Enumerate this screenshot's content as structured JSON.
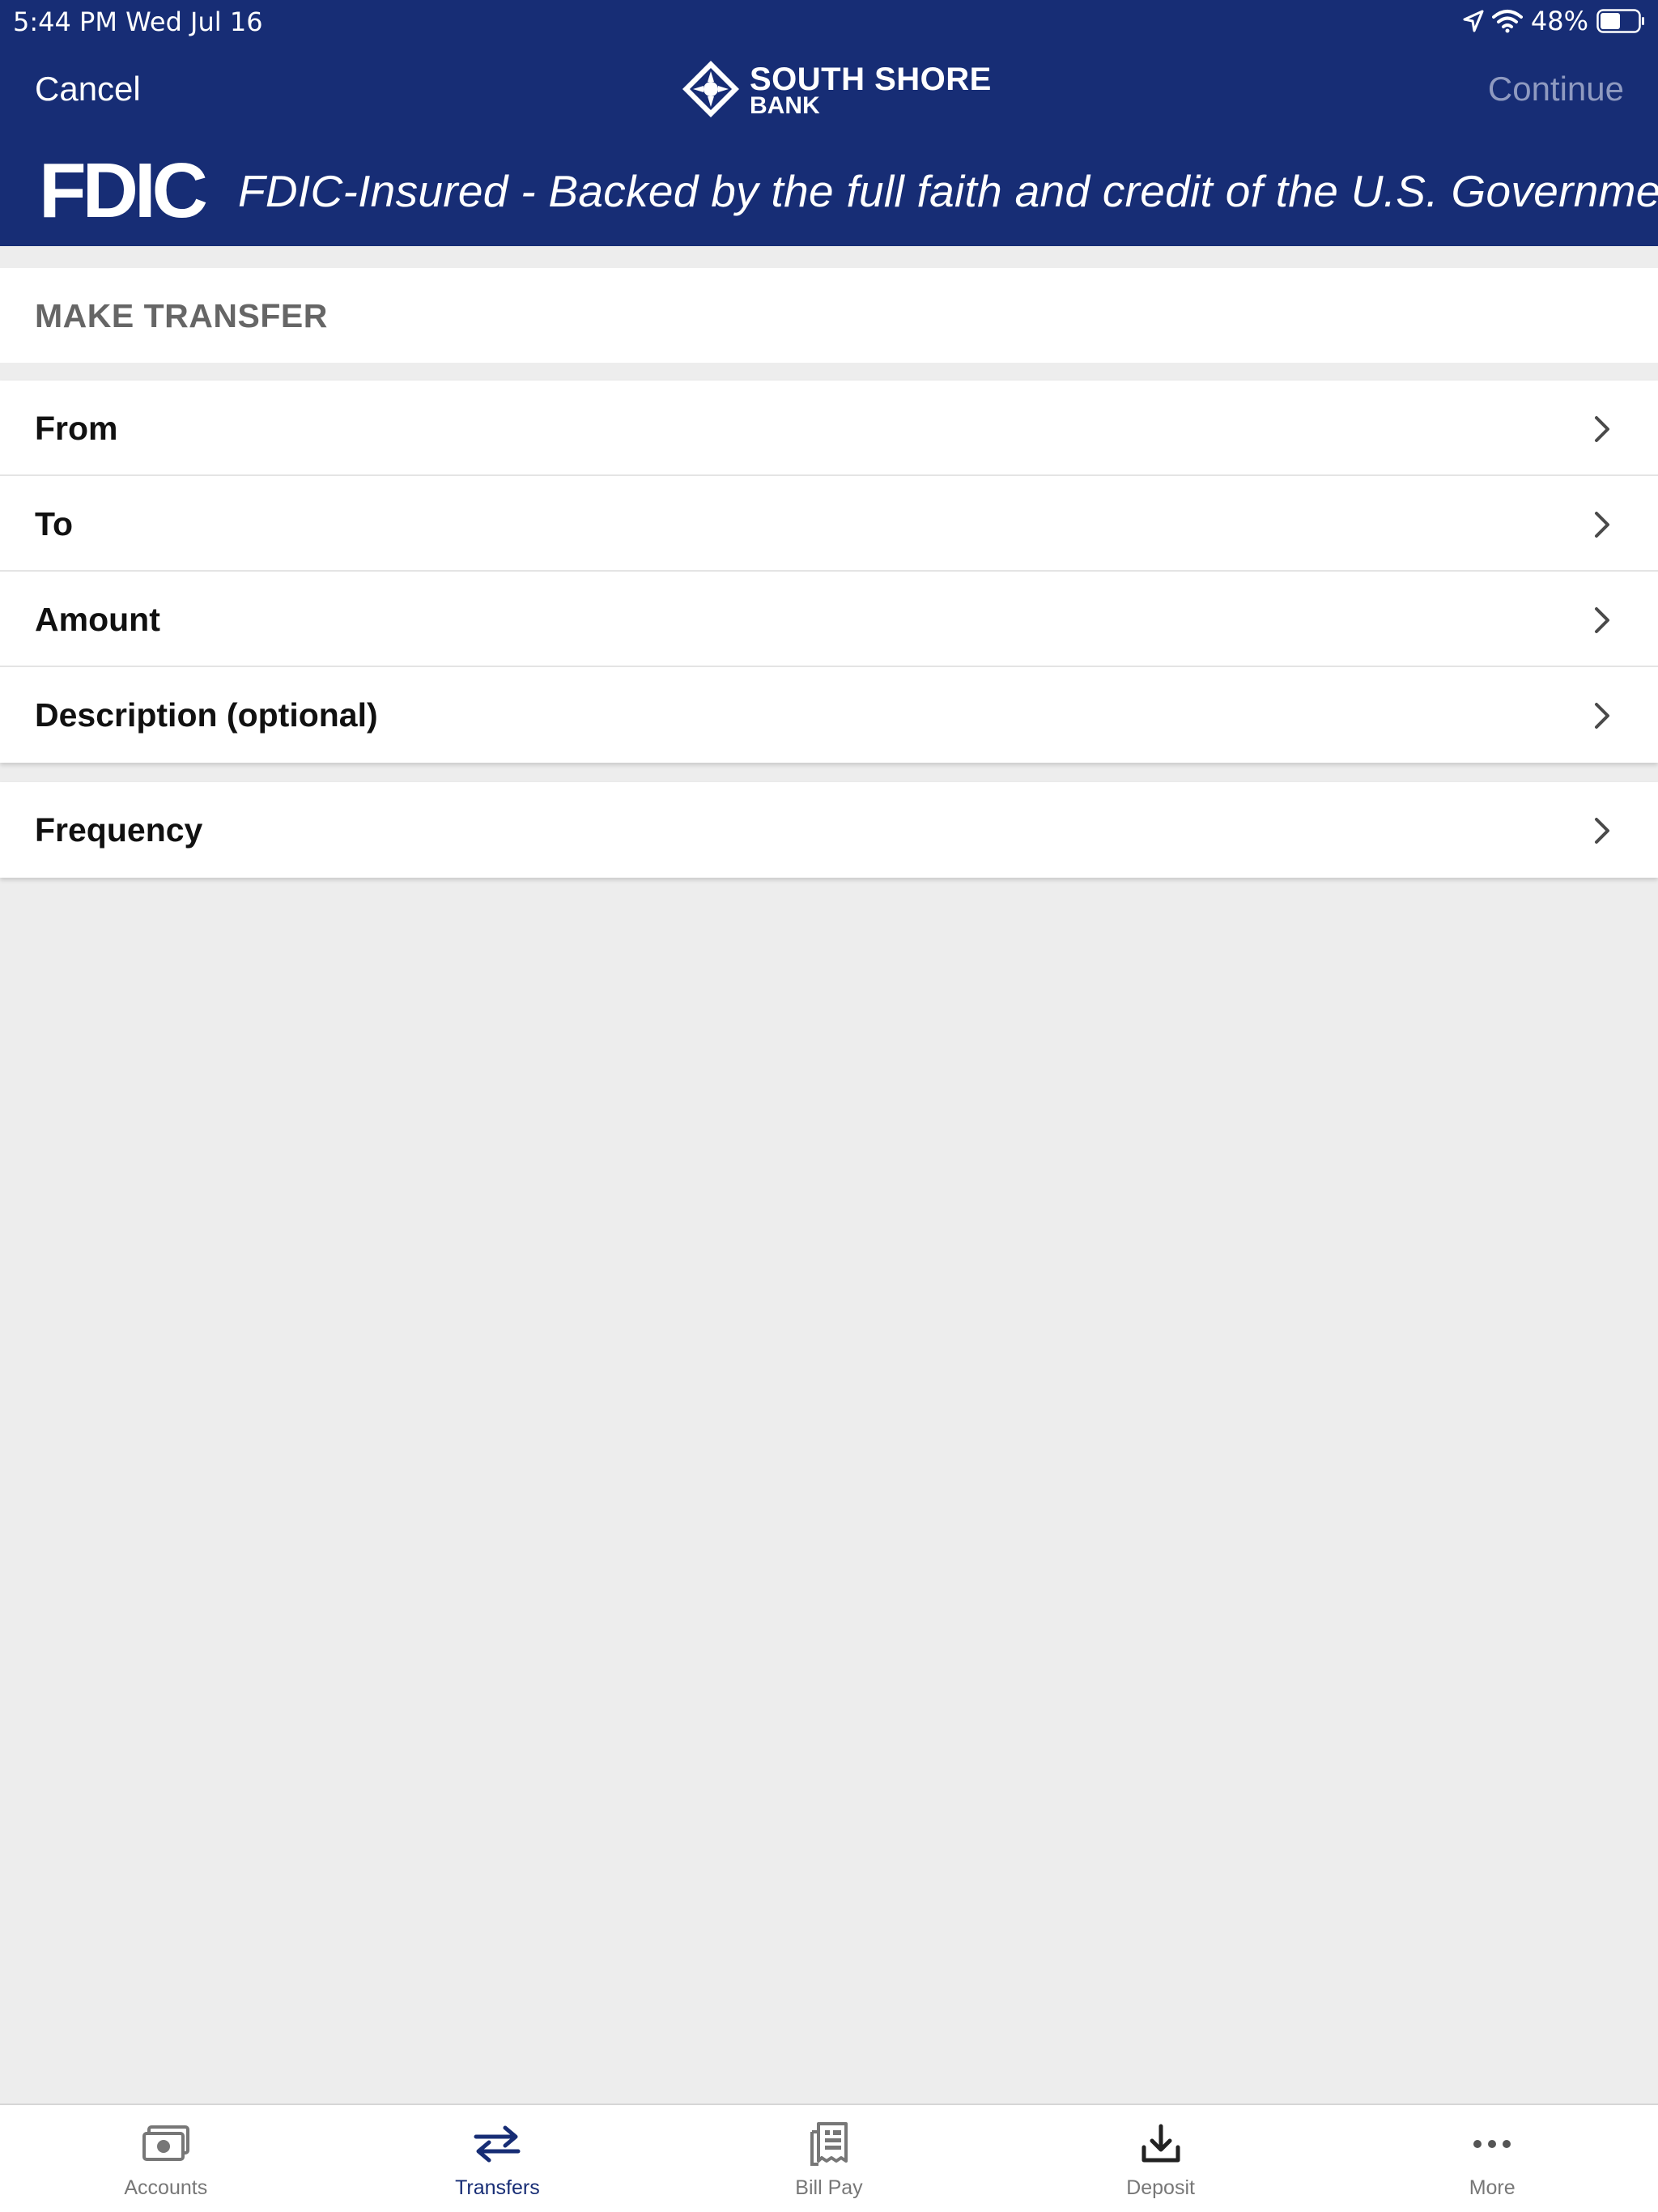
{
  "status_bar": {
    "time_date": "5:44 PM   Wed Jul 16",
    "battery": "48%"
  },
  "nav": {
    "cancel_label": "Cancel",
    "continue_label": "Continue",
    "logo_line1": "SOUTH SHORE",
    "logo_line2": "BANK"
  },
  "fdic": {
    "logo_text": "FDIC",
    "tagline": "FDIC-Insured - Backed by the full faith and credit of the U.S. Government"
  },
  "section": {
    "title": "MAKE TRANSFER"
  },
  "form": {
    "rows": [
      {
        "label": "From"
      },
      {
        "label": "To"
      },
      {
        "label": "Amount"
      },
      {
        "label": "Description (optional)"
      }
    ],
    "frequency": {
      "label": "Frequency"
    }
  },
  "tabbar": {
    "tabs": [
      {
        "label": "Accounts",
        "icon": "accounts-icon"
      },
      {
        "label": "Transfers",
        "icon": "transfer-arrows-icon",
        "active": true
      },
      {
        "label": "Bill Pay",
        "icon": "bill-icon"
      },
      {
        "label": "Deposit",
        "icon": "download-icon"
      },
      {
        "label": "More",
        "icon": "more-dots-icon"
      }
    ]
  },
  "colors": {
    "brand_navy": "#172d75",
    "background": "#ededed",
    "continue_disabled": "#8f9ac0",
    "tab_inactive": "#777777"
  }
}
